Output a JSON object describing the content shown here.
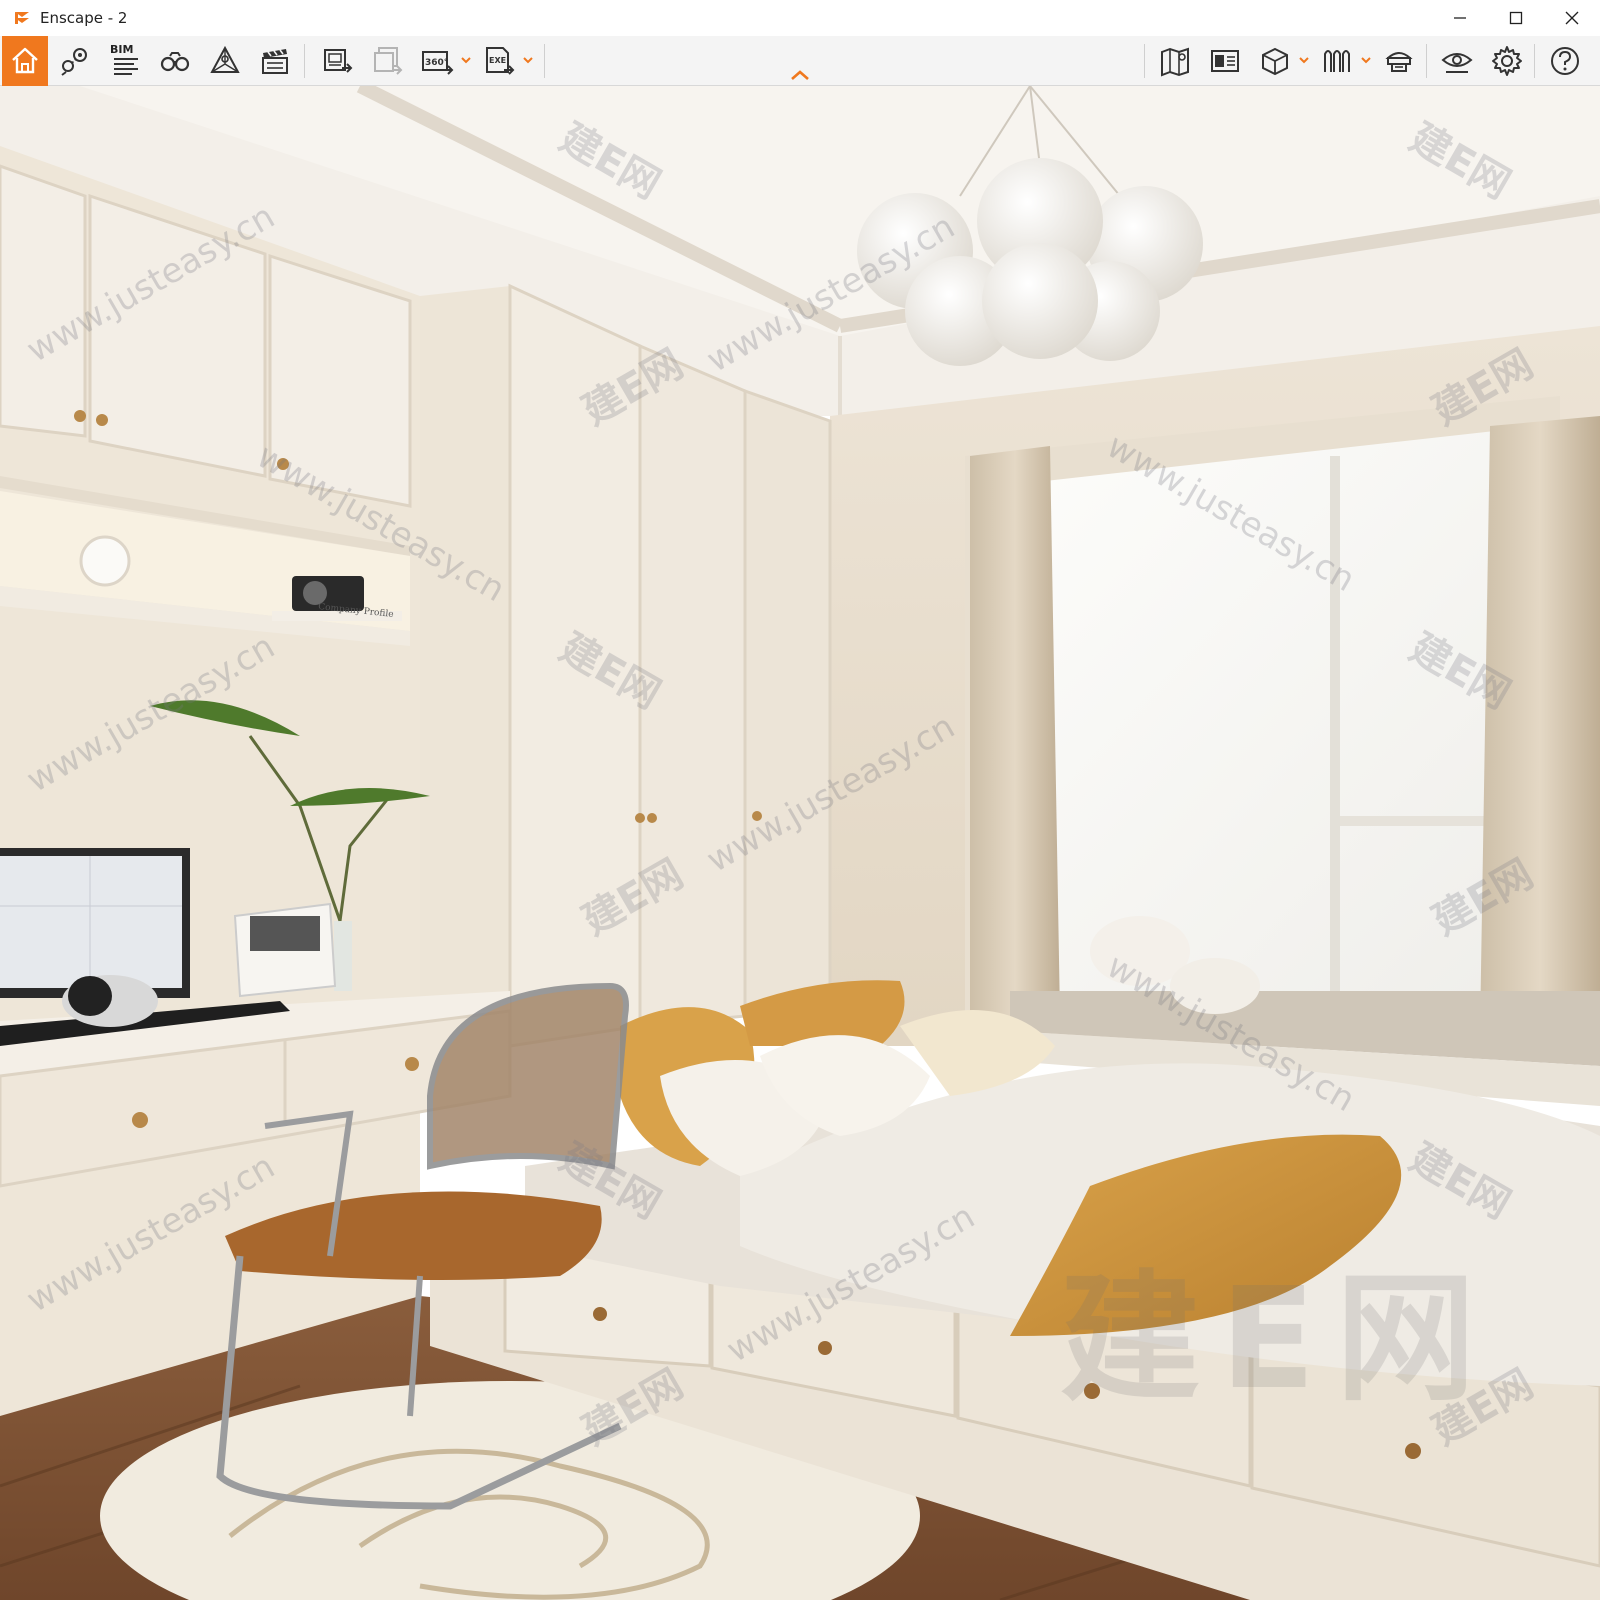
{
  "window": {
    "title": "Enscape - 2",
    "controls": [
      "minimize",
      "maximize",
      "close"
    ]
  },
  "toolbar": {
    "accent_color": "#f0781e",
    "left_tools": [
      {
        "id": "home",
        "icon": "home-icon",
        "active": true
      },
      {
        "id": "views",
        "icon": "location-pin-icon"
      },
      {
        "id": "bim",
        "icon": "bim-info-icon",
        "label": "BIM"
      },
      {
        "id": "walk",
        "icon": "binoculars-icon"
      },
      {
        "id": "assets",
        "icon": "asset-library-icon"
      },
      {
        "id": "video",
        "icon": "clapperboard-icon"
      }
    ],
    "export_tools": [
      {
        "id": "screenshot",
        "icon": "screenshot-export-icon"
      },
      {
        "id": "batch",
        "icon": "batch-render-icon",
        "disabled": true
      },
      {
        "id": "panorama",
        "icon": "panorama-360-icon",
        "label": "360°",
        "dropdown": true
      },
      {
        "id": "exe",
        "icon": "exe-export-icon",
        "label": "EXE",
        "dropdown": true
      }
    ],
    "right_tools": [
      {
        "id": "map",
        "icon": "map-icon"
      },
      {
        "id": "material",
        "icon": "material-editor-icon"
      },
      {
        "id": "cube",
        "icon": "cube-icon",
        "dropdown": true
      },
      {
        "id": "vr",
        "icon": "vr-headset-icon",
        "dropdown": true
      },
      {
        "id": "hat",
        "icon": "visual-settings-icon"
      },
      {
        "id": "eye",
        "icon": "eye-icon"
      },
      {
        "id": "settings",
        "icon": "gear-icon"
      },
      {
        "id": "help",
        "icon": "help-icon"
      }
    ],
    "collapse_icon": "chevron-up-icon"
  },
  "scene": {
    "description_label": "bedroom render viewport",
    "watermarks": {
      "url_text": "www.justeasy.cn",
      "cn_text": "建E网",
      "big_text": "建E网"
    },
    "book_text": "Company Profile"
  }
}
